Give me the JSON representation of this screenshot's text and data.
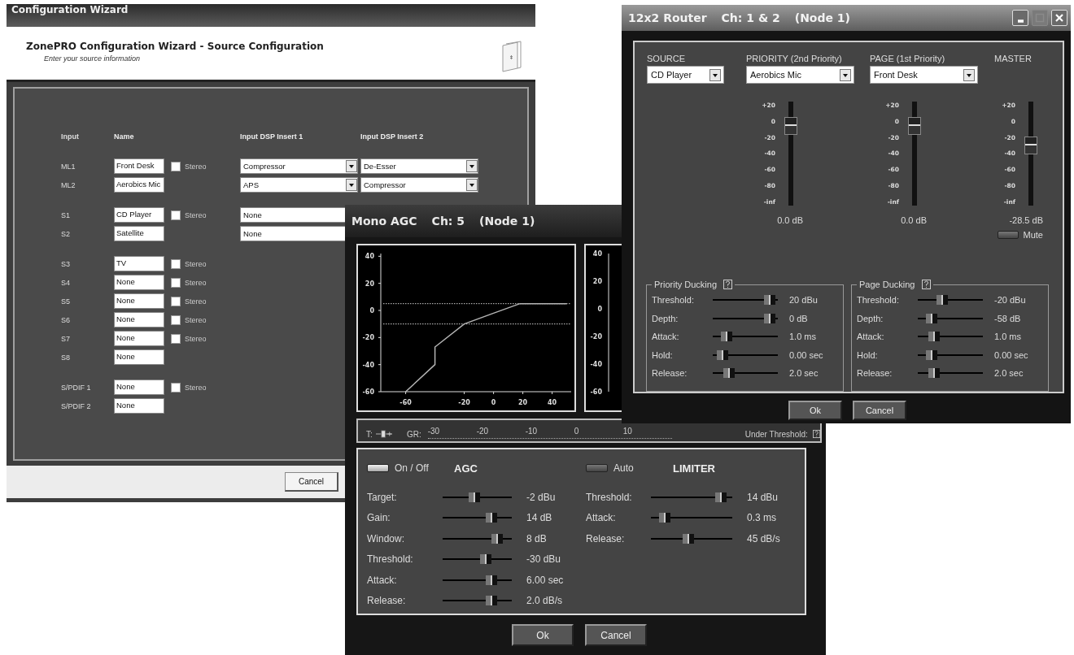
{
  "wizard": {
    "title": "Configuration Wizard",
    "heading": "ZonePRO Configuration Wizard - Source Configuration",
    "subheading": "Enter your source information",
    "columns": [
      "Input",
      "Name",
      "Input DSP Insert 1",
      "Input DSP Insert 2"
    ],
    "groups": [
      {
        "rows": [
          {
            "input": "ML1",
            "name": "Front Desk",
            "stereo": {
              "label": "Stereo",
              "checked": false
            },
            "insert1": "Compressor",
            "insert2": "De-Esser"
          },
          {
            "input": "ML2",
            "name": "Aerobics Mic",
            "insert1": "APS",
            "insert2": "Compressor"
          }
        ]
      },
      {
        "rows": [
          {
            "input": "S1",
            "name": "CD Player",
            "stereo": {
              "label": "Stereo",
              "checked": false
            },
            "insert1": "None"
          },
          {
            "input": "S2",
            "name": "Satellite",
            "insert1": "None"
          }
        ]
      },
      {
        "rows": [
          {
            "input": "S3",
            "name": "TV",
            "stereo": {
              "label": "Stereo",
              "checked": false
            }
          },
          {
            "input": "S4",
            "name": "None",
            "stereo": {
              "label": "Stereo",
              "checked": false
            }
          },
          {
            "input": "S5",
            "name": "None",
            "stereo": {
              "label": "Stereo",
              "checked": false
            }
          },
          {
            "input": "S6",
            "name": "None",
            "stereo": {
              "label": "Stereo",
              "checked": false
            }
          },
          {
            "input": "S7",
            "name": "None",
            "stereo": {
              "label": "Stereo",
              "checked": false
            }
          },
          {
            "input": "S8",
            "name": "None"
          }
        ]
      },
      {
        "rows": [
          {
            "input": "S/PDIF 1",
            "name": "None",
            "stereo": {
              "label": "Stereo",
              "checked": false
            }
          },
          {
            "input": "S/PDIF 2",
            "name": "None"
          }
        ]
      }
    ],
    "buttons": [
      "Cancel"
    ]
  },
  "agc": {
    "title_parts": [
      "Mono AGC",
      "Ch: 5",
      "(Node 1)"
    ],
    "chart": {
      "chart_data": {
        "type": "line",
        "x": [
          -60,
          -40,
          -40,
          -20,
          0,
          18,
          50
        ],
        "series": [
          {
            "color": "#b4b4b4",
            "values": [
              -60,
              -40,
              -27,
              -10,
              -2,
              5,
              5
            ]
          }
        ],
        "xlim": [
          -77,
          53
        ],
        "ylim": [
          -60,
          42
        ],
        "xticks": [
          -60,
          -20,
          0,
          20,
          40
        ],
        "yticks": [
          40,
          20,
          0,
          -20,
          -40,
          -60
        ],
        "ref_lines": [
          {
            "axis": "y",
            "value": 5
          },
          {
            "axis": "y",
            "value": -10
          }
        ]
      }
    },
    "limiter_graph": {
      "yticks": [
        "40",
        "20",
        "0",
        "-20",
        "-40",
        "-60"
      ]
    },
    "meter": {
      "t_label": "T:",
      "gr_label": "GR:",
      "scale": [
        "-30",
        "-20",
        "-10",
        "0",
        "10"
      ],
      "under_label": "Under Threshold:"
    },
    "agc_section": {
      "toggle": {
        "label": "On / Off",
        "on": true
      },
      "title": "AGC",
      "params": [
        {
          "label": "Target:",
          "level": 0.45,
          "value": "-2 dBu"
        },
        {
          "label": "Gain:",
          "level": 0.75,
          "value": "14 dB"
        },
        {
          "label": "Window:",
          "level": 0.85,
          "value": "8 dB"
        },
        {
          "label": "Threshold:",
          "level": 0.65,
          "value": "-30 dBu"
        },
        {
          "label": "Attack:",
          "level": 0.75,
          "value": "6.00 sec"
        },
        {
          "label": "Release:",
          "level": 0.75,
          "value": "2.0 dB/s"
        }
      ]
    },
    "limiter_section": {
      "toggle": {
        "label": "Auto",
        "on": false
      },
      "title": "LIMITER",
      "params": [
        {
          "label": "Threshold:",
          "level": 0.92,
          "value": "14 dBu"
        },
        {
          "label": "Attack:",
          "level": 0.12,
          "value": "0.3 ms"
        },
        {
          "label": "Release:",
          "level": 0.45,
          "value": "45 dB/s"
        }
      ]
    },
    "buttons": [
      "Ok",
      "Cancel"
    ]
  },
  "router": {
    "title_parts": [
      "12x2 Router",
      "Ch: 1 & 2",
      "(Node 1)"
    ],
    "window_buttons": [
      {
        "kind": "minimize",
        "disabled": false
      },
      {
        "kind": "maximize",
        "disabled": true
      },
      {
        "kind": "close",
        "disabled": false
      }
    ],
    "columns": [
      {
        "label": "SOURCE",
        "select": "CD Player"
      },
      {
        "label": "PRIORITY (2nd Priority)",
        "select": "Aerobics Mic",
        "fader": {
          "scale": [
            "+20",
            "0",
            "-20",
            "-40",
            "-60",
            "-80",
            "-inf"
          ],
          "level": 0.82,
          "reading": "0.0 dB"
        }
      },
      {
        "label": "PAGE (1st Priority)",
        "select": "Front Desk",
        "fader": {
          "scale": [
            "+20",
            "0",
            "-20",
            "-40",
            "-60",
            "-80",
            "-inf"
          ],
          "level": 0.82,
          "reading": "0.0 dB"
        }
      },
      {
        "label": "MASTER",
        "fader": {
          "scale": [
            "+20",
            "0",
            "-20",
            "-40",
            "-60",
            "-80",
            "-inf"
          ],
          "level": 0.59,
          "reading": "-28.5 dB"
        },
        "mute": {
          "label": "Mute",
          "on": false
        }
      }
    ],
    "ducking": [
      {
        "title": "Priority Ducking",
        "params": [
          {
            "label": "Threshold:",
            "level": 0.95,
            "value": "20 dBu"
          },
          {
            "label": "Depth:",
            "level": 0.95,
            "value": "0 dB"
          },
          {
            "label": "Attack:",
            "level": 0.15,
            "value": "1.0 ms"
          },
          {
            "label": "Hold:",
            "level": 0.08,
            "value": "0.00 sec"
          },
          {
            "label": "Release:",
            "level": 0.2,
            "value": "2.0 sec"
          }
        ]
      },
      {
        "title": "Page Ducking",
        "params": [
          {
            "label": "Threshold:",
            "level": 0.35,
            "value": "-20 dBu"
          },
          {
            "label": "Depth:",
            "level": 0.15,
            "value": "-58 dB"
          },
          {
            "label": "Attack:",
            "level": 0.2,
            "value": "1.0 ms"
          },
          {
            "label": "Hold:",
            "level": 0.15,
            "value": "0.00 sec"
          },
          {
            "label": "Release:",
            "level": 0.2,
            "value": "2.0 sec"
          }
        ]
      }
    ],
    "buttons": [
      "Ok",
      "Cancel"
    ]
  }
}
